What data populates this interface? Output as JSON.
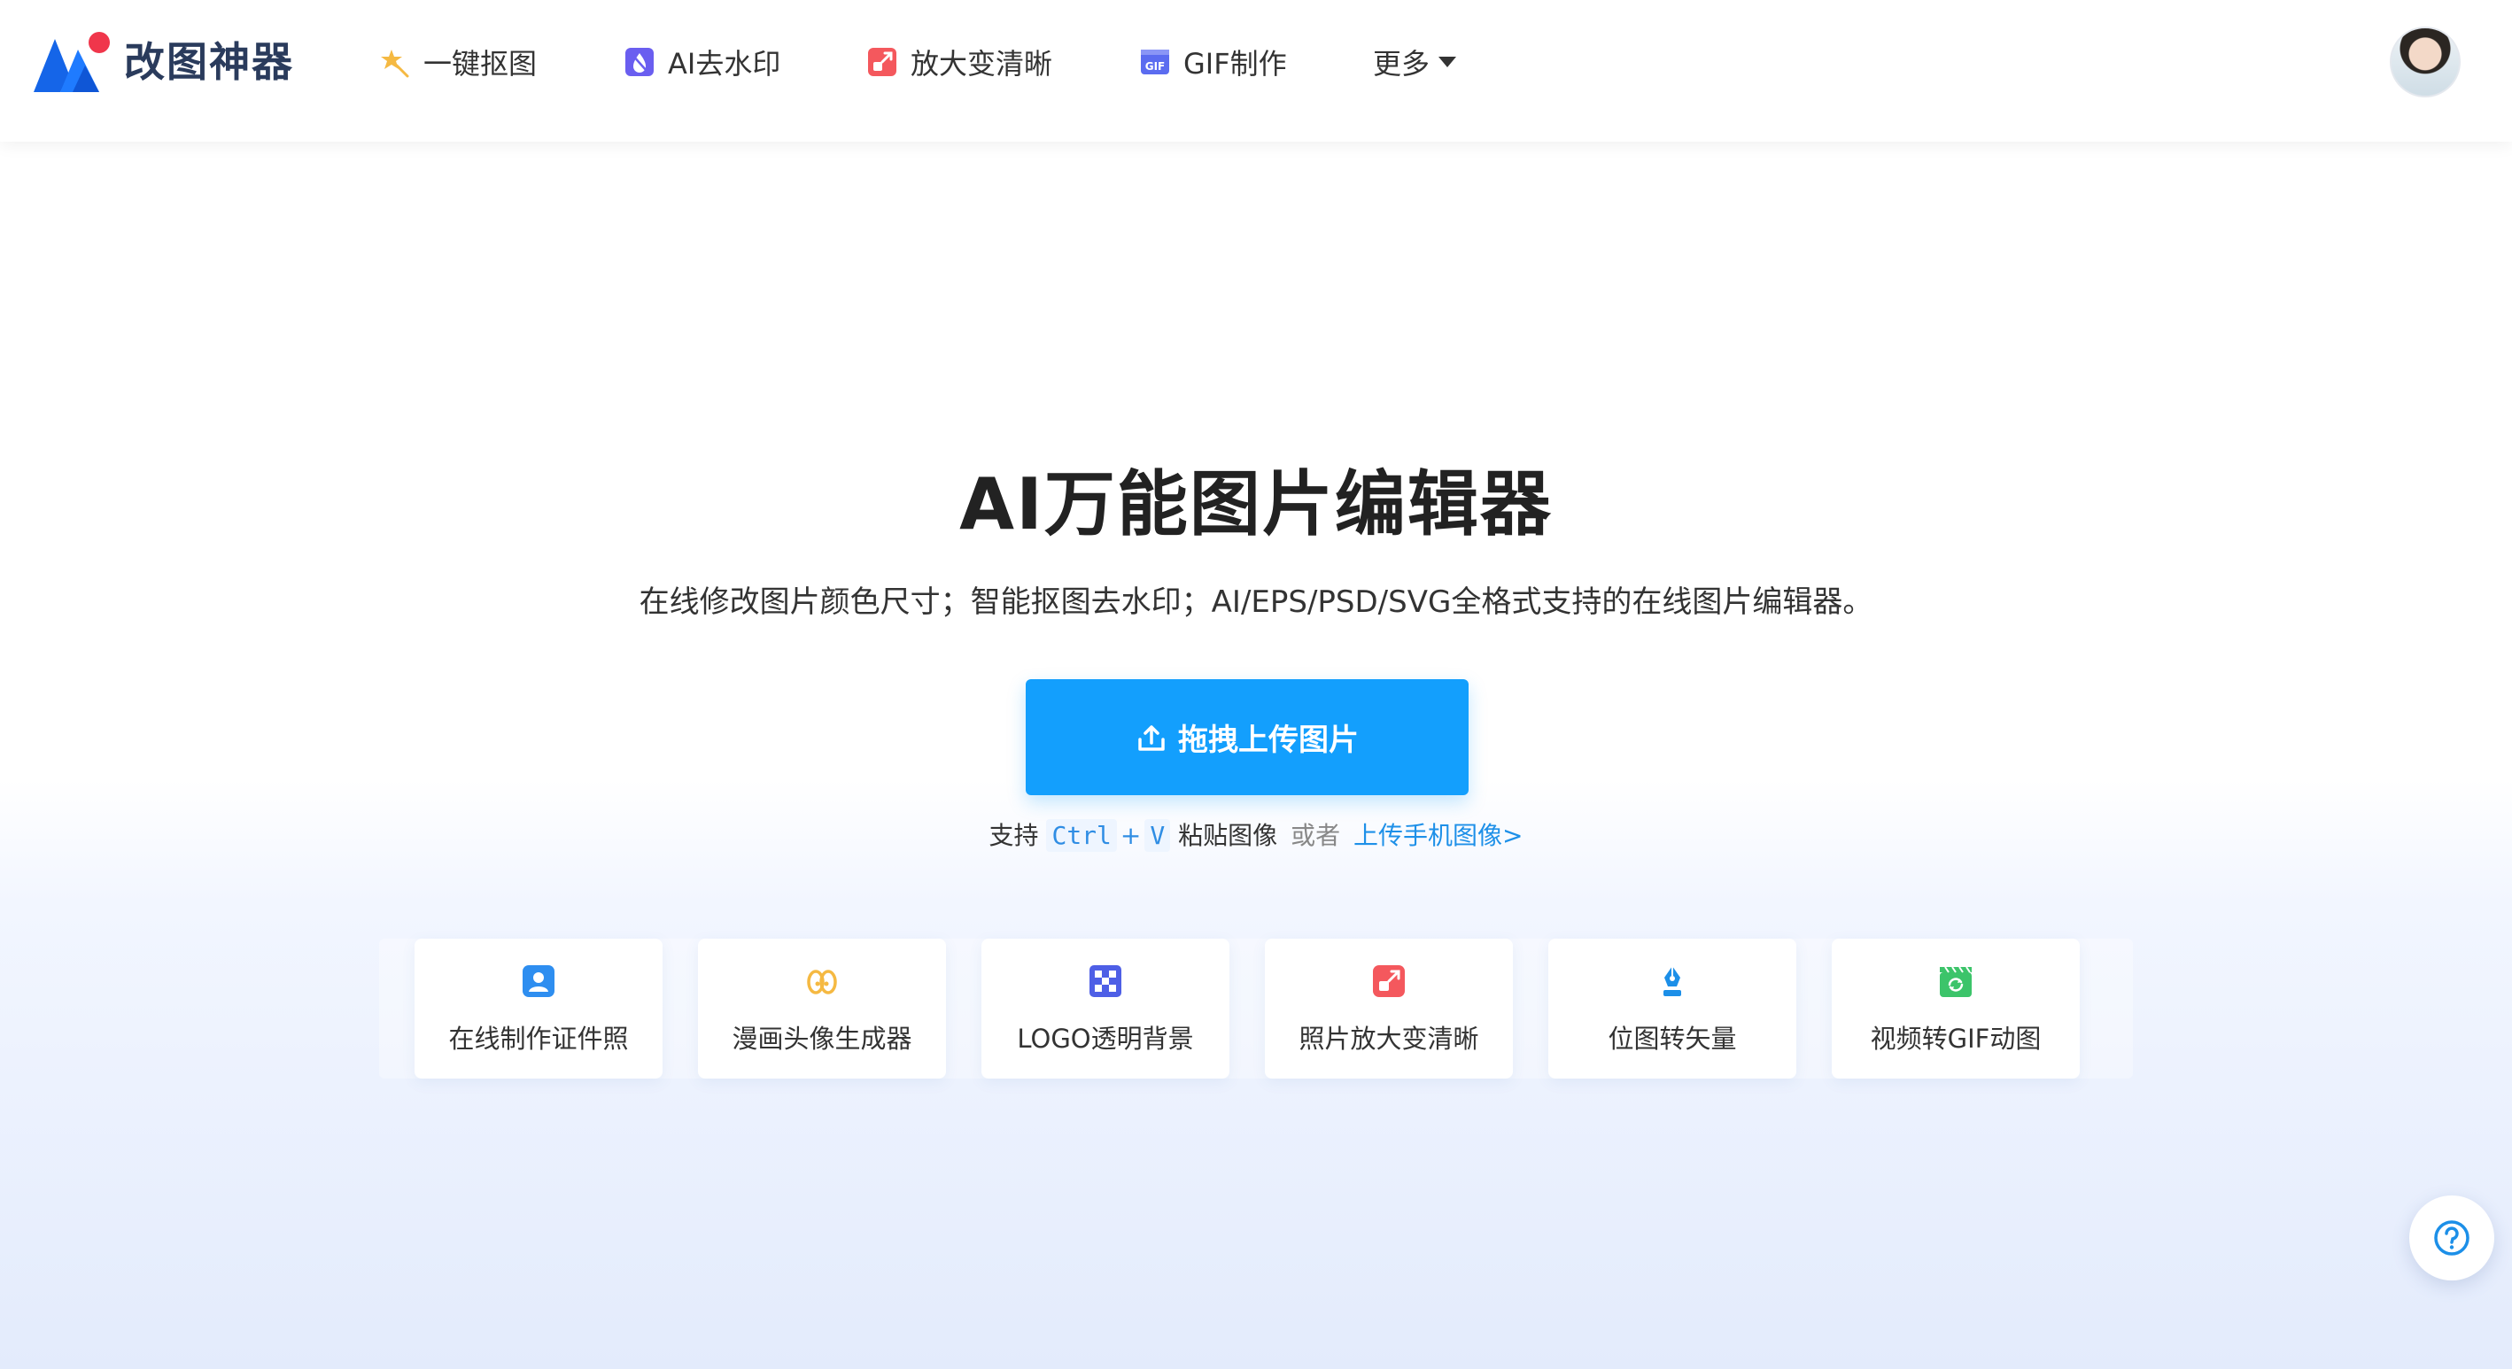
{
  "header": {
    "brand": "改图神器",
    "nav": [
      {
        "label": "一键抠图",
        "icon": "star-wand-icon"
      },
      {
        "label": "AI去水印",
        "icon": "water-drop-icon"
      },
      {
        "label": "放大变清晰",
        "icon": "enlarge-icon"
      },
      {
        "label": "GIF制作",
        "icon": "gif-icon"
      }
    ],
    "more_label": "更多"
  },
  "hero": {
    "title": "AI万能图片编辑器",
    "subtitle": "在线修改图片颜色尺寸；智能抠图去水印；AI/EPS/PSD/SVG全格式支持的在线图片编辑器。",
    "upload_label": "拖拽上传图片",
    "hint_prefix": "支持",
    "hint_ctrl": "Ctrl",
    "hint_plus": "+",
    "hint_v": "V",
    "hint_paste": "粘贴图像",
    "hint_or": "或者",
    "hint_phone": "上传手机图像>"
  },
  "tools": [
    {
      "label": "在线制作证件照",
      "icon": "id-photo-icon"
    },
    {
      "label": "漫画头像生成器",
      "icon": "cartoon-avatar-icon"
    },
    {
      "label": "LOGO透明背景",
      "icon": "transparent-grid-icon"
    },
    {
      "label": "照片放大变清晰",
      "icon": "enlarge-icon"
    },
    {
      "label": "位图转矢量",
      "icon": "pen-nib-icon"
    },
    {
      "label": "视频转GIF动图",
      "icon": "video-gif-icon"
    }
  ],
  "colors": {
    "primary": "#139ffd",
    "brand_blue": "#1565e8",
    "brand_red": "#f0364b"
  }
}
